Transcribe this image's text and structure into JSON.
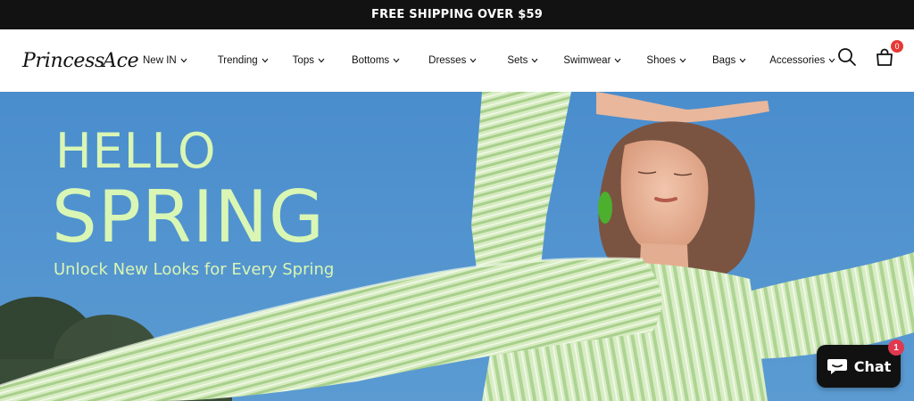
{
  "announcement": "FREE SHIPPING OVER $59",
  "logo": {
    "text": "PrincessAce",
    "part1": "Princess",
    "part2": "Ace"
  },
  "nav": [
    {
      "label": "New IN",
      "has_dropdown": true
    },
    {
      "label": "Trending",
      "has_dropdown": true
    },
    {
      "label": "Tops",
      "has_dropdown": true
    },
    {
      "label": "Bottoms",
      "has_dropdown": true
    },
    {
      "label": "Dresses",
      "has_dropdown": true
    },
    {
      "label": "Sets",
      "has_dropdown": true
    },
    {
      "label": "Swimwear",
      "has_dropdown": true
    },
    {
      "label": "Shoes",
      "has_dropdown": true
    },
    {
      "label": "Bags",
      "has_dropdown": true
    },
    {
      "label": "Accessories",
      "has_dropdown": true
    }
  ],
  "header_icons": {
    "search": "search-icon",
    "cart": "shopping-bag-icon",
    "cart_count": "0"
  },
  "hero": {
    "title_line1": "HELLO",
    "title_line2": "SPRING",
    "subtitle": "Unlock New Looks for Every Spring"
  },
  "chat": {
    "label": "Chat",
    "icon": "chat-bubble-icon",
    "badge": "1"
  },
  "colors": {
    "announcement_bg": "#121212",
    "hero_sky": "#4f90c9",
    "hero_text": "#d9f6b4",
    "badge_red": "#e53935",
    "chat_bg": "#111111"
  }
}
